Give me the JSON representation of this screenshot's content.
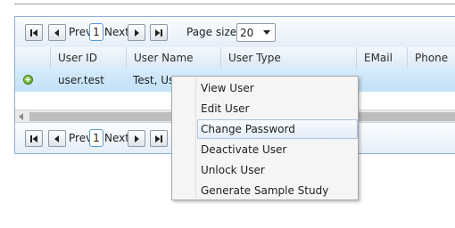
{
  "pager_top": {
    "prev_label": "Prev",
    "next_label": "Next",
    "page_number": "1",
    "page_size_label": "Page size:",
    "page_size_value": "20"
  },
  "pager_bottom": {
    "prev_label": "Prev",
    "next_label": "Next",
    "page_number": "1"
  },
  "grid": {
    "columns": [
      "User ID",
      "User Name",
      "User Type",
      "EMail",
      "Phone"
    ],
    "rows": [
      {
        "user_id": "user.test",
        "user_name": "Test, Use"
      }
    ]
  },
  "context_menu": {
    "items": [
      "View User",
      "Edit User",
      "Change Password",
      "Deactivate User",
      "Unlock User",
      "Generate Sample Study"
    ],
    "highlighted": "Change Password"
  },
  "icons": {
    "first": "first-page-icon",
    "prev": "prev-page-icon",
    "next": "next-page-icon",
    "last": "last-page-icon",
    "expand": "expand-row-icon",
    "dropdown": "chevron-down-icon",
    "scroll": "scroll-left-icon"
  },
  "colors": {
    "header_border": "#8fb0d3",
    "selected_row": "#c9e4f8",
    "menu_highlight_border": "#a9c3e2"
  }
}
